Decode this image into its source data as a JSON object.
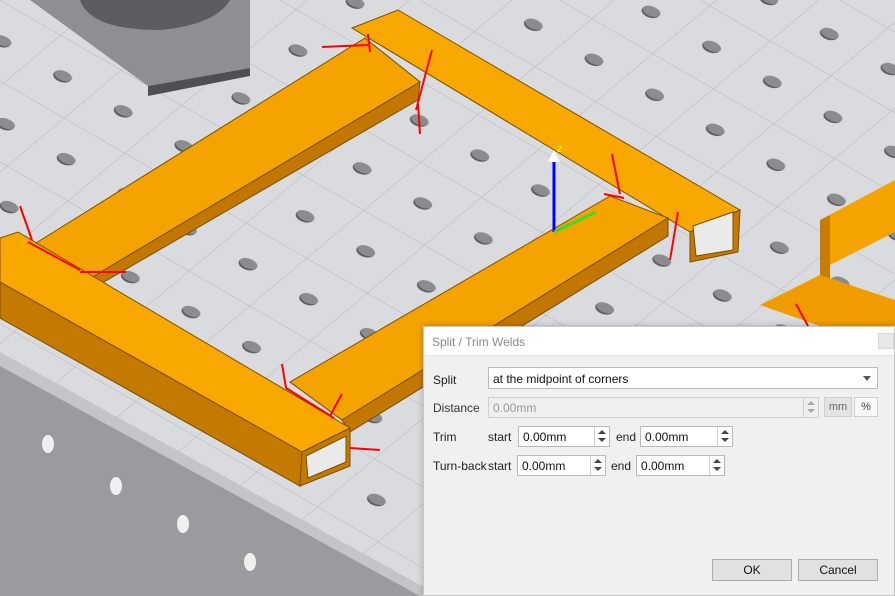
{
  "dialog": {
    "title": "Split / Trim Welds",
    "split": {
      "label": "Split",
      "value": "at the midpoint of corners"
    },
    "distance": {
      "label": "Distance",
      "value": "0.00mm",
      "unit_mm": "mm",
      "unit_pct": "%"
    },
    "trim": {
      "label": "Trim",
      "start_label": "start",
      "start_value": "0.00mm",
      "end_label": "end",
      "end_value": "0.00mm"
    },
    "turnback": {
      "label": "Turn-back",
      "start_label": "start",
      "start_value": "0.00mm",
      "end_label": "end",
      "end_value": "0.00mm"
    },
    "ok_label": "OK",
    "cancel_label": "Cancel"
  },
  "scene": {
    "tube_color": "#f5a300",
    "table_color": "#d7d9dc",
    "weld_marker_color": "#ff0000",
    "axis_z_label": "z"
  }
}
